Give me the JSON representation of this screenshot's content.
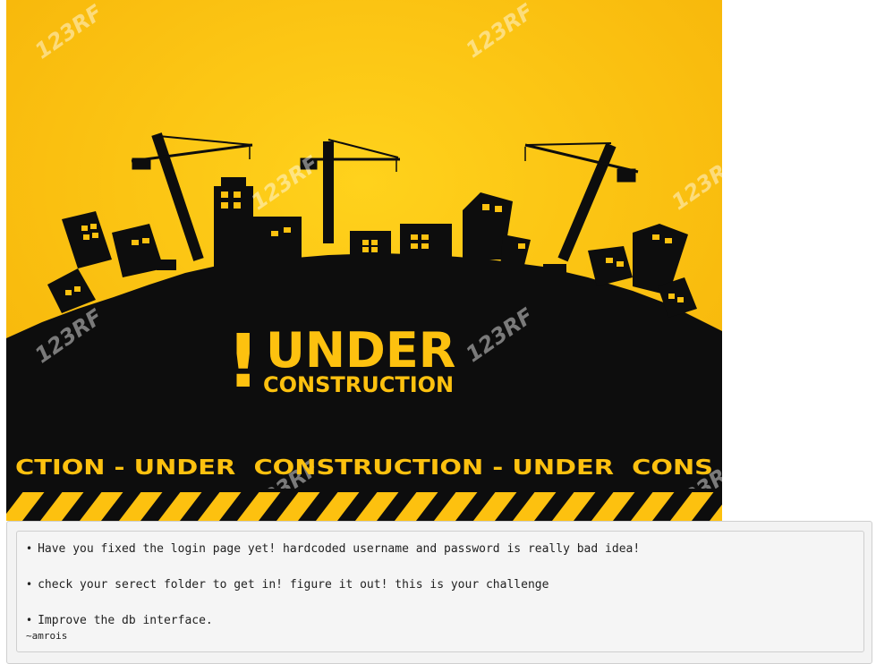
{
  "banner": {
    "headline": "UNDER",
    "subheadline": "CONSTRUCTION",
    "exclamation": "!",
    "ticker": "CTION - UNDER  CONSTRUCTION - UNDER  CONS",
    "watermark": "123RF",
    "colors": {
      "yellow": "#fdc10f",
      "black": "#0d0d0d"
    }
  },
  "notes": [
    {
      "bullet": "•",
      "text": "Have you fixed the login page yet! hardcoded username and password is really bad idea!"
    },
    {
      "bullet": "•",
      "text": "check your serect folder to get in! figure it out! this is your challenge"
    },
    {
      "bullet": "•",
      "text": "Improve the db interface."
    }
  ],
  "signature": "~amrois"
}
